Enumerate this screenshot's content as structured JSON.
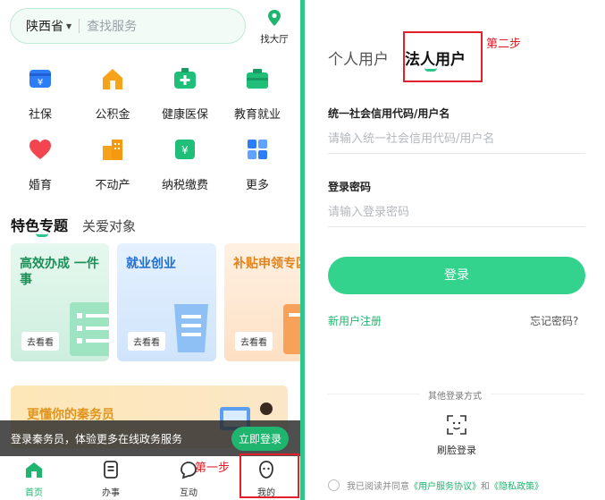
{
  "home": {
    "search": {
      "province": "陕西省",
      "placeholder": "查找服务"
    },
    "hall_label": "找大厅",
    "services": [
      {
        "label": "社保",
        "icon": "wallet-icon"
      },
      {
        "label": "公积金",
        "icon": "house-icon"
      },
      {
        "label": "健康医保",
        "icon": "medical-kit-icon"
      },
      {
        "label": "教育就业",
        "icon": "briefcase-icon"
      },
      {
        "label": "婚育",
        "icon": "heart-icon"
      },
      {
        "label": "不动产",
        "icon": "building-icon"
      },
      {
        "label": "纳税缴费",
        "icon": "tax-icon"
      },
      {
        "label": "更多",
        "icon": "grid-icon"
      }
    ],
    "tabs": {
      "active": "特色专题",
      "other": "关爱对象"
    },
    "cards": [
      {
        "title": "高效办成 一件事",
        "button": "去看看"
      },
      {
        "title": "就业创业",
        "button": "去看看"
      },
      {
        "title": "补贴申领专区",
        "button": "去看看"
      }
    ],
    "banner_title": "更懂你的秦务员",
    "login_strip": {
      "text": "登录秦务员，体验更多在线政务服务",
      "button": "立即登录"
    },
    "bottom_nav": [
      {
        "label": "首页",
        "icon": "home-icon"
      },
      {
        "label": "办事",
        "icon": "document-icon"
      },
      {
        "label": "互动",
        "icon": "chat-icon"
      },
      {
        "label": "我的",
        "icon": "profile-icon"
      }
    ],
    "annotation_step1": "第一步"
  },
  "login": {
    "tabs": {
      "personal": "个人用户",
      "corporate": "法人用户"
    },
    "annotation_step2": "第二步",
    "fields": [
      {
        "label": "统一社会信用代码/用户名",
        "placeholder": "请输入统一社会信用代码/用户名"
      },
      {
        "label": "登录密码",
        "placeholder": "请输入登录密码"
      }
    ],
    "login_button": "登录",
    "register_link": "新用户注册",
    "forgot_link": "忘记密码?",
    "other_methods_label": "其他登录方式",
    "face_login": "刷脸登录",
    "agreement": {
      "prefix": "我已阅读并同意",
      "service": "《用户服务协议》",
      "and": "和",
      "privacy": "《隐私政策》"
    }
  },
  "colors": {
    "brand_green": "#2fc58d",
    "button_green": "#33d38e",
    "annotation_red": "#e0202a"
  }
}
